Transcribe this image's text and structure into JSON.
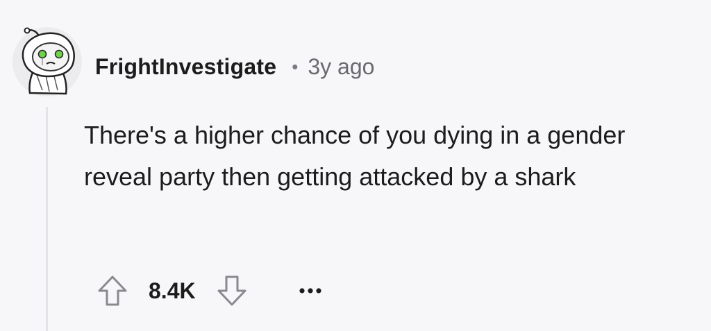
{
  "comment": {
    "username": "FrightInvestigate",
    "separator": "•",
    "age": "3y ago",
    "text": "There's a higher chance of you dying in a gender reveal party then getting attacked by a shark",
    "score": "8.4K"
  },
  "icons": {
    "avatar": "ghost-avatar-icon",
    "upvote": "upvote-arrow-icon",
    "downvote": "downvote-arrow-icon",
    "more": "more-options-icon"
  },
  "colors": {
    "background": "#f7f7f9",
    "text": "#1c1c1c",
    "meta": "#6a6a6e",
    "icon": "#8a8a8e",
    "avatar_eyes": "#6fd24a"
  }
}
